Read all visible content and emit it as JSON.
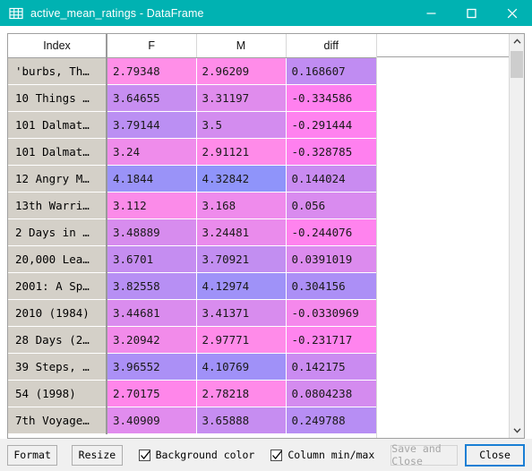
{
  "window": {
    "title": "active_mean_ratings - DataFrame",
    "icon": "table-grid-icon",
    "titlebar_color": "#00b2b2",
    "controls": {
      "minimize": "minimize-icon",
      "maximize": "maximize-icon",
      "close": "close-icon"
    }
  },
  "table": {
    "columns": [
      "Index",
      "F",
      "M",
      "diff"
    ],
    "rows": [
      {
        "index": "'burbs, Th…",
        "F": "2.79348",
        "M": "2.96209",
        "diff": "0.168607",
        "colors": {
          "F": "#ff8fe8",
          "M": "#ff8ce9",
          "diff": "#c08cf2"
        }
      },
      {
        "index": "10 Things …",
        "F": "3.64655",
        "M": "3.31197",
        "diff": "-0.334586",
        "colors": {
          "F": "#c78ef1",
          "M": "#e08ced",
          "diff": "#ff80ef"
        }
      },
      {
        "index": "101 Dalmat…",
        "F": "3.79144",
        "M": "3.5",
        "diff": "-0.291444",
        "colors": {
          "F": "#bb8ff3",
          "M": "#d38cef",
          "diff": "#ff82ef"
        }
      },
      {
        "index": "101 Dalmat…",
        "F": "3.24",
        "M": "2.91121",
        "diff": "-0.328785",
        "colors": {
          "F": "#ef8ceb",
          "M": "#ff8be9",
          "diff": "#ff80ef"
        }
      },
      {
        "index": "12 Angry M…",
        "F": "4.1844",
        "M": "4.32842",
        "diff": "0.144024",
        "colors": {
          "F": "#9a93f8",
          "M": "#8f94fa",
          "diff": "#c98bf1"
        }
      },
      {
        "index": "13th Warri…",
        "F": "3.112",
        "M": "3.168",
        "diff": "0.056",
        "colors": {
          "F": "#fb8be9",
          "M": "#ef8bec",
          "diff": "#d98bef"
        }
      },
      {
        "index": "2 Days in …",
        "F": "3.48889",
        "M": "3.24481",
        "diff": "-0.244076",
        "colors": {
          "F": "#d78cee",
          "M": "#ea8bec",
          "diff": "#ff83ee"
        }
      },
      {
        "index": "20,000 Lea…",
        "F": "3.6701",
        "M": "3.70921",
        "diff": "0.0391019",
        "colors": {
          "F": "#c58df1",
          "M": "#c28ef1",
          "diff": "#dc8bee"
        }
      },
      {
        "index": "2001: A Sp…",
        "F": "3.82558",
        "M": "4.12974",
        "diff": "0.304156",
        "colors": {
          "F": "#b78ff4",
          "M": "#9f92f8",
          "diff": "#ac8ff6"
        }
      },
      {
        "index": "2010 (1984)",
        "F": "3.44681",
        "M": "3.41371",
        "diff": "-0.0330969",
        "colors": {
          "F": "#da8cee",
          "M": "#d88cee",
          "diff": "#f588ec"
        }
      },
      {
        "index": "28 Days (2…",
        "F": "3.20942",
        "M": "2.97771",
        "diff": "-0.231717",
        "colors": {
          "F": "#f28bea",
          "M": "#ff8be9",
          "diff": "#ff84ee"
        }
      },
      {
        "index": "39 Steps, …",
        "F": "3.96552",
        "M": "4.10769",
        "diff": "0.142175",
        "colors": {
          "F": "#ab90f6",
          "M": "#a091f8",
          "diff": "#ca8bf1"
        }
      },
      {
        "index": "54 (1998)",
        "F": "2.70175",
        "M": "2.78218",
        "diff": "0.0804238",
        "colors": {
          "F": "#ff86ea",
          "M": "#ff8ae9",
          "diff": "#d48bef"
        }
      },
      {
        "index": "7th Voyage…",
        "F": "3.40909",
        "M": "3.65888",
        "diff": "0.249788",
        "colors": {
          "F": "#e18cee",
          "M": "#c68df1",
          "diff": "#b78ef4"
        }
      }
    ]
  },
  "scrollbar": {
    "up_arrow": "chevron-up-icon",
    "down_arrow": "chevron-down-icon",
    "thumb": "scroll-thumb"
  },
  "toolbar": {
    "format_label": "Format",
    "resize_label": "Resize",
    "background_color_label": "Background color",
    "background_color_checked": true,
    "column_minmax_label": "Column min/max",
    "column_minmax_checked": true,
    "save_and_close_label": "Save and Close",
    "save_and_close_enabled": false,
    "close_label": "Close",
    "focus_color": "#1a7fd4"
  }
}
